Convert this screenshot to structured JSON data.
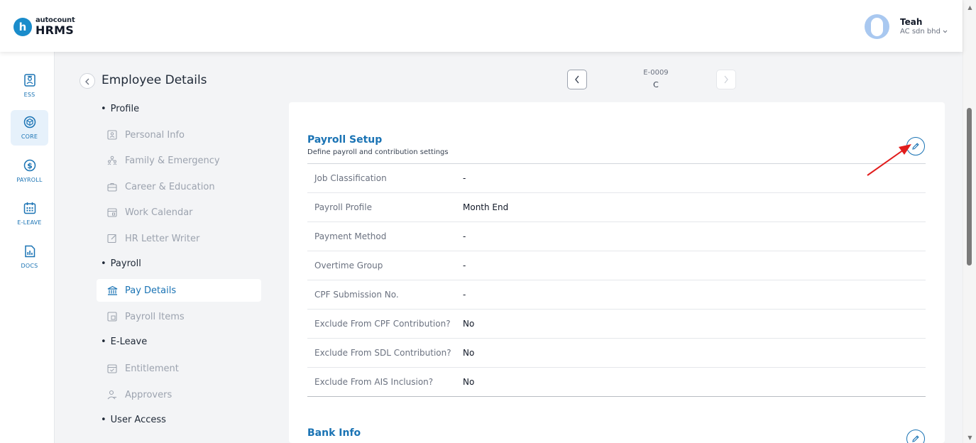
{
  "app": {
    "logo_letter": "h",
    "logo_small": "autocount",
    "logo_big": "HRMS",
    "brand_color": "#1a8ccb",
    "accent_color": "#1a73b4"
  },
  "user": {
    "name": "Teah",
    "company": "AC sdn bhd"
  },
  "rail": {
    "items": [
      {
        "label": "ESS",
        "icon": "ess-icon",
        "active": false
      },
      {
        "label": "CORE",
        "icon": "core-icon",
        "active": true
      },
      {
        "label": "PAYROLL",
        "icon": "payroll-icon",
        "active": false
      },
      {
        "label": "E-LEAVE",
        "icon": "calendar-icon",
        "active": false
      },
      {
        "label": "DOCS",
        "icon": "docs-icon",
        "active": false
      }
    ]
  },
  "header": {
    "title": "Employee Details",
    "employee_code": "E-0009",
    "employee_name": "C"
  },
  "subnav": {
    "sections": [
      {
        "label": "Profile"
      },
      {
        "label": "Payroll"
      },
      {
        "label": "E-Leave"
      },
      {
        "label": "User Access"
      }
    ],
    "items": [
      {
        "label": "Personal Info",
        "icon": "id-card-icon"
      },
      {
        "label": "Family & Emergency",
        "icon": "family-icon"
      },
      {
        "label": "Career & Education",
        "icon": "briefcase-icon"
      },
      {
        "label": "Work Calendar",
        "icon": "calendar-icon"
      },
      {
        "label": "HR Letter Writer",
        "icon": "letter-icon"
      },
      {
        "label": "Pay Details",
        "icon": "bank-icon",
        "active": true
      },
      {
        "label": "Payroll Items",
        "icon": "payroll-items-icon"
      },
      {
        "label": "Entitlement",
        "icon": "calendar-check-icon"
      },
      {
        "label": "Approvers",
        "icon": "user-check-icon"
      }
    ]
  },
  "payroll_setup": {
    "title": "Payroll Setup",
    "subtitle": "Define payroll and contribution settings",
    "rows": [
      {
        "label": "Job Classification",
        "value": "-"
      },
      {
        "label": "Payroll Profile",
        "value": "Month End"
      },
      {
        "label": "Payment Method",
        "value": "-"
      },
      {
        "label": "Overtime Group",
        "value": "-"
      },
      {
        "label": "CPF Submission No.",
        "value": "-"
      },
      {
        "label": "Exclude From CPF Contribution?",
        "value": "No"
      },
      {
        "label": "Exclude From SDL Contribution?",
        "value": "No"
      },
      {
        "label": "Exclude From AIS Inclusion?",
        "value": "No"
      }
    ]
  },
  "bank_info": {
    "title": "Bank Info"
  }
}
